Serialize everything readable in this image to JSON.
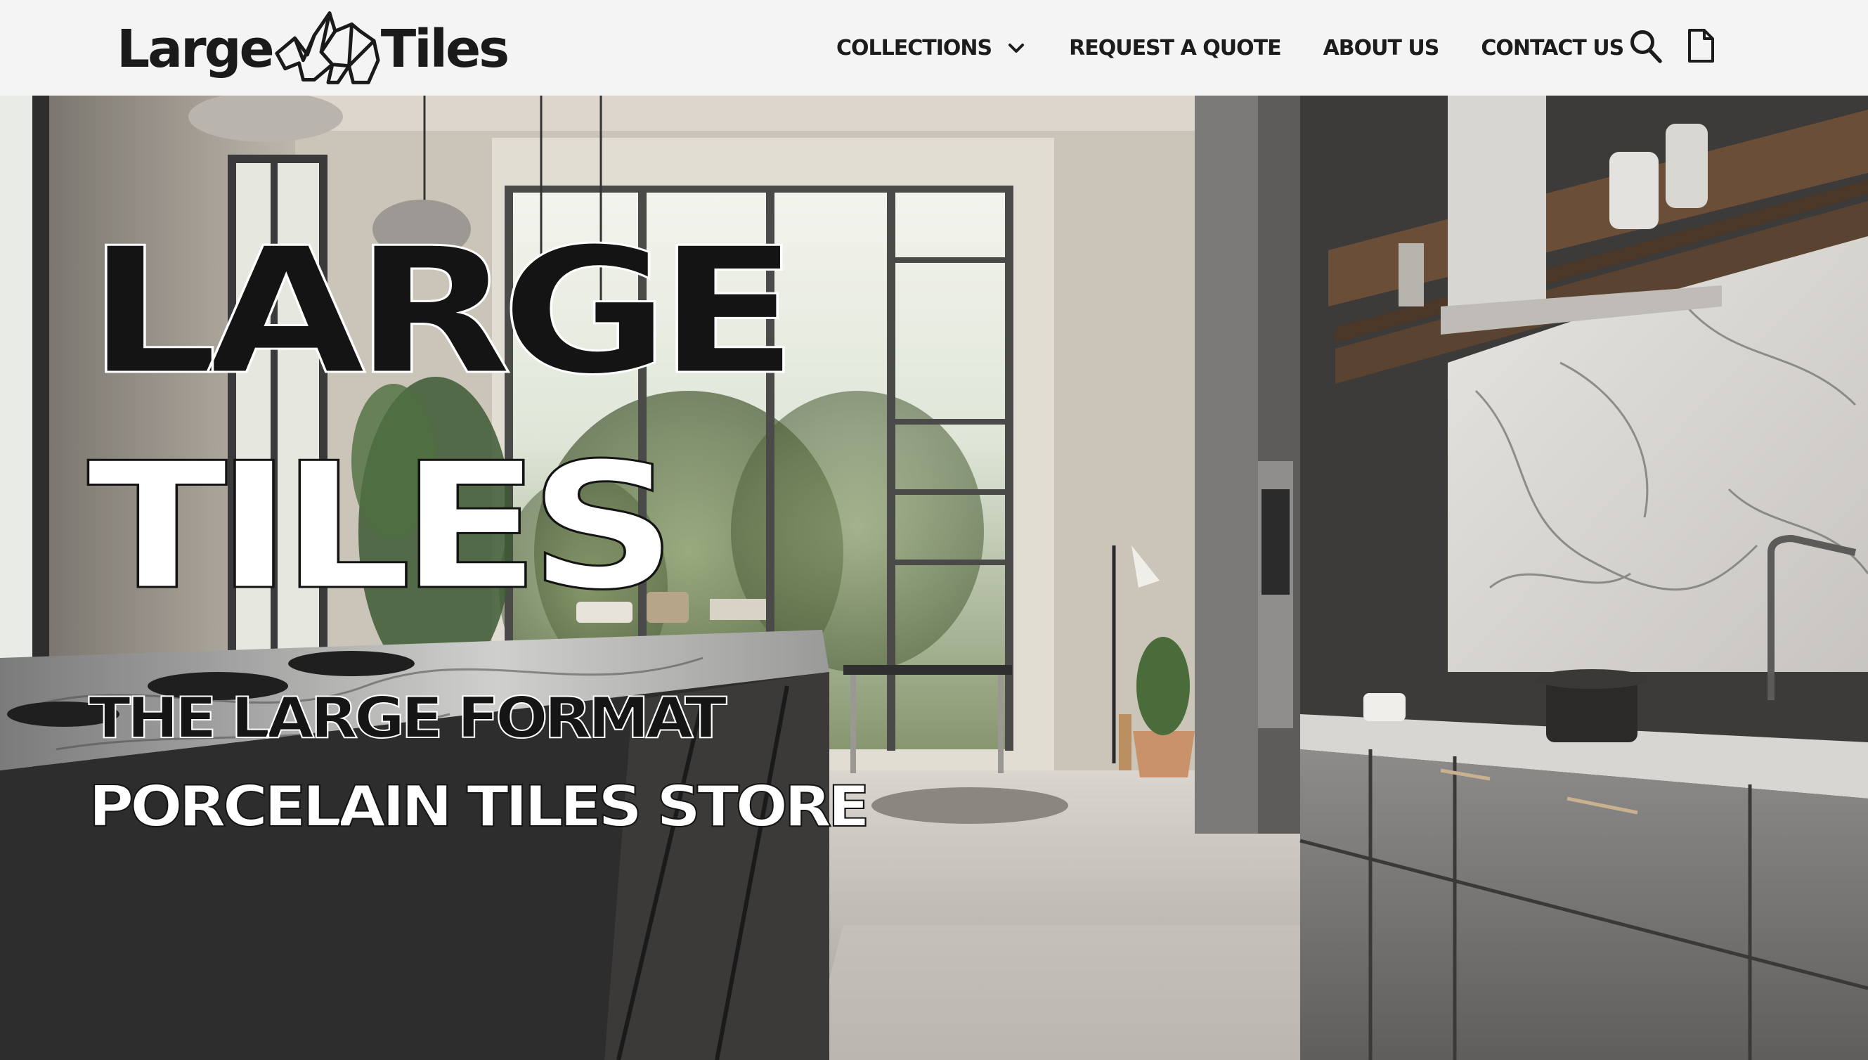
{
  "brand": {
    "logo_left": "Large",
    "logo_right": "Tiles",
    "logo_mark": "origami-rhino-mark"
  },
  "nav": {
    "items": [
      {
        "label": "COLLECTIONS",
        "has_dropdown": true
      },
      {
        "label": "REQUEST A QUOTE"
      },
      {
        "label": "ABOUT US"
      },
      {
        "label": "CONTACT US"
      }
    ],
    "icons": [
      "search-icon",
      "document-icon",
      "chevron-down-icon"
    ]
  },
  "hero": {
    "title_line1": "LARGE",
    "title_line2": "TILES",
    "subtitle_line1": "THE LARGE FORMAT",
    "subtitle_line2": "PORCELAIN TILES STORE"
  },
  "colors": {
    "header_bg": "#f4f4f4",
    "text_dark": "#141414",
    "text_light": "#ffffff"
  }
}
